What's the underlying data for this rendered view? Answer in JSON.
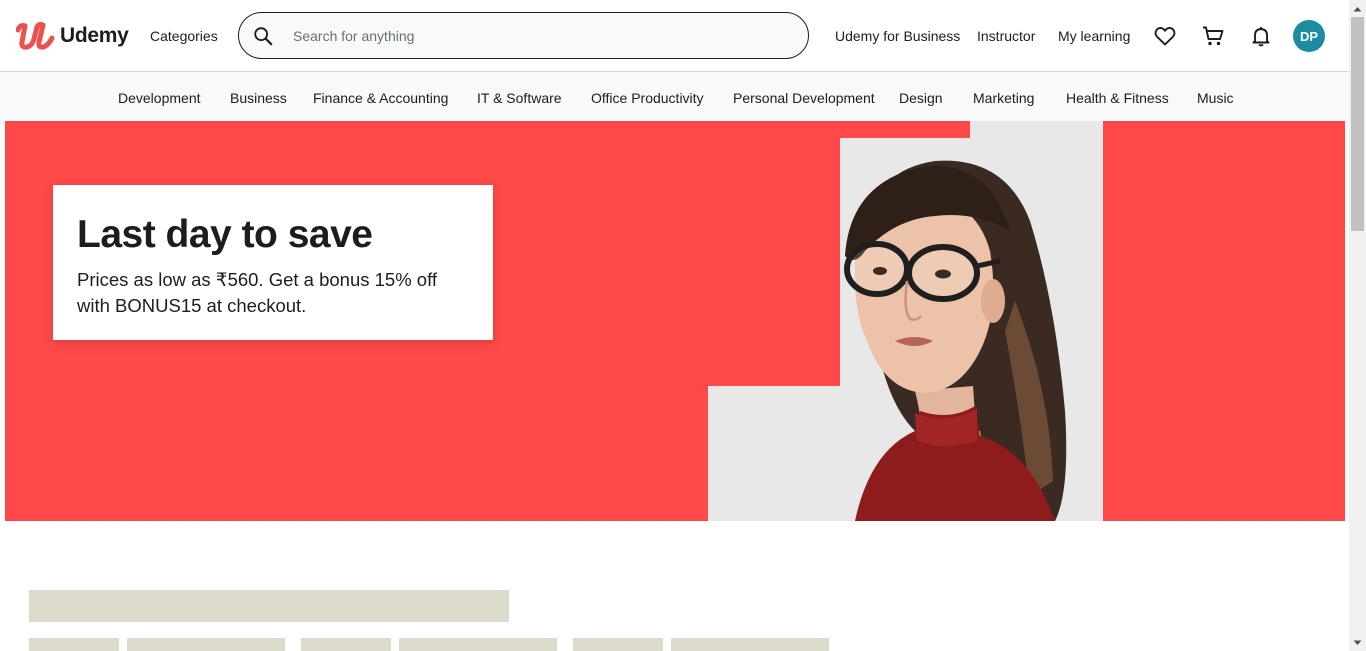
{
  "header": {
    "brand": "Udemy",
    "categories_label": "Categories",
    "search_placeholder": "Search for anything",
    "business_link": "Udemy for Business",
    "instructor_link": "Instructor",
    "my_learning_link": "My learning",
    "avatar_initials": "DP"
  },
  "category_bar": {
    "items": [
      "Development",
      "Business",
      "Finance & Accounting",
      "IT & Software",
      "Office Productivity",
      "Personal Development",
      "Design",
      "Marketing",
      "Health & Fitness",
      "Music"
    ]
  },
  "hero": {
    "title": "Last day to save",
    "text": "Prices as low as ₹560. Get a bonus 15% off with BONUS15 at checkout."
  },
  "icons": {
    "logo": "udemy-logo",
    "search": "search-icon",
    "wishlist": "heart-icon",
    "cart": "cart-icon",
    "notifications": "bell-icon"
  },
  "colors": {
    "brand_red": "#ea5252",
    "hero_bg": "#ff4848",
    "avatar_bg": "#1c8ca0",
    "skeleton": "#dcdacb"
  }
}
